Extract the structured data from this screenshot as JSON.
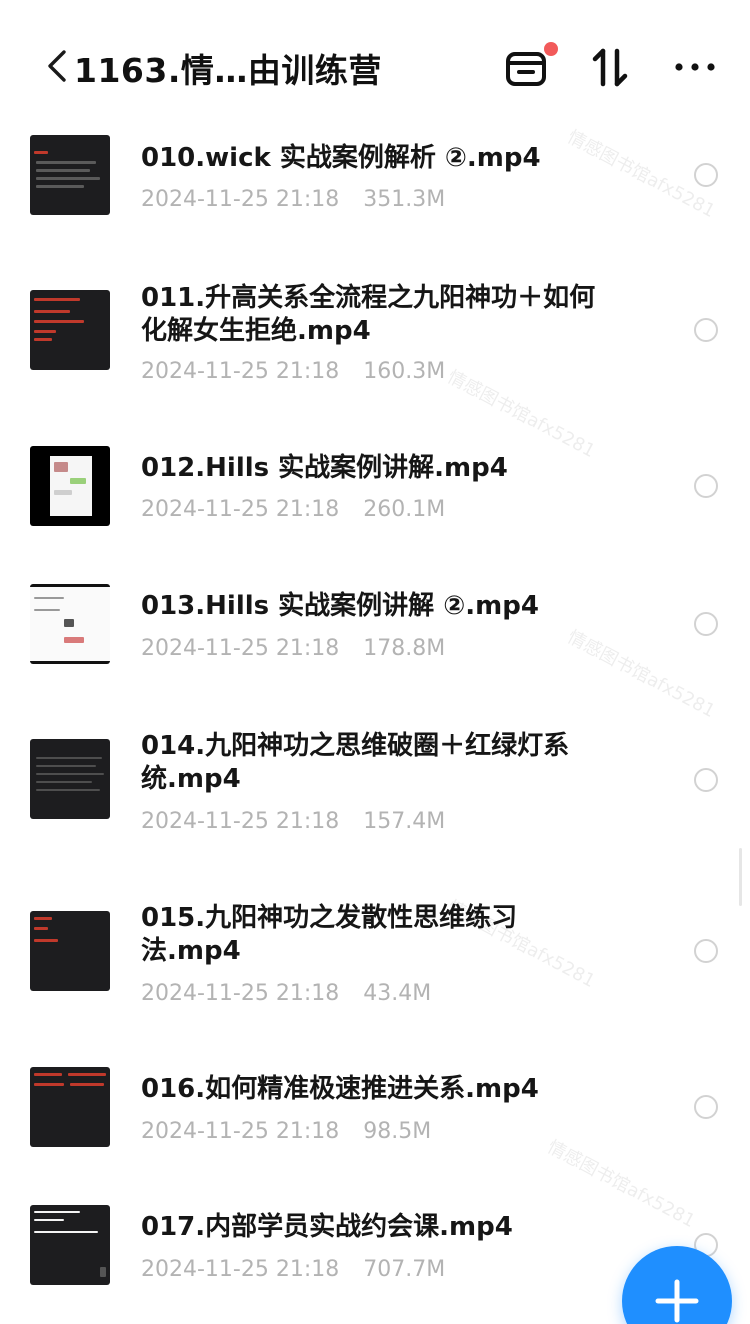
{
  "header": {
    "title": "1163.情…由训练营",
    "back_icon": "chevron-left-icon",
    "transfer_icon": "tray-icon",
    "sort_icon": "sort-icon",
    "more_icon": "more-icon",
    "notification_dot_color": "#f25a5a"
  },
  "files": [
    {
      "name": "010.wick 实战案例解析 ②.mp4",
      "date": "2024-11-25 21:18",
      "size": "351.3M"
    },
    {
      "name": "011.升高关系全流程之九阳神功＋如何化解女生拒绝.mp4",
      "date": "2024-11-25 21:18",
      "size": "160.3M"
    },
    {
      "name": "012.Hills 实战案例讲解.mp4",
      "date": "2024-11-25 21:18",
      "size": "260.1M"
    },
    {
      "name": "013.Hills 实战案例讲解 ②.mp4",
      "date": "2024-11-25 21:18",
      "size": "178.8M"
    },
    {
      "name": "014.九阳神功之思维破圈＋红绿灯系统.mp4",
      "date": "2024-11-25 21:18",
      "size": "157.4M"
    },
    {
      "name": "015.九阳神功之发散性思维练习法.mp4",
      "date": "2024-11-25 21:18",
      "size": "43.4M"
    },
    {
      "name": "016.如何精准极速推进关系.mp4",
      "date": "2024-11-25 21:18",
      "size": "98.5M"
    },
    {
      "name": "017.内部学员实战约会课.mp4",
      "date": "2024-11-25 21:18",
      "size": "707.7M"
    }
  ],
  "watermark_text": "情感图书馆afx5281",
  "fab": {
    "icon": "plus-icon",
    "color": "#1f8fff"
  },
  "colors": {
    "thumbnail_bg": "#1d1d1f",
    "thumbnail_text_red": "#c0392b",
    "meta_text": "#b3b3b3"
  }
}
